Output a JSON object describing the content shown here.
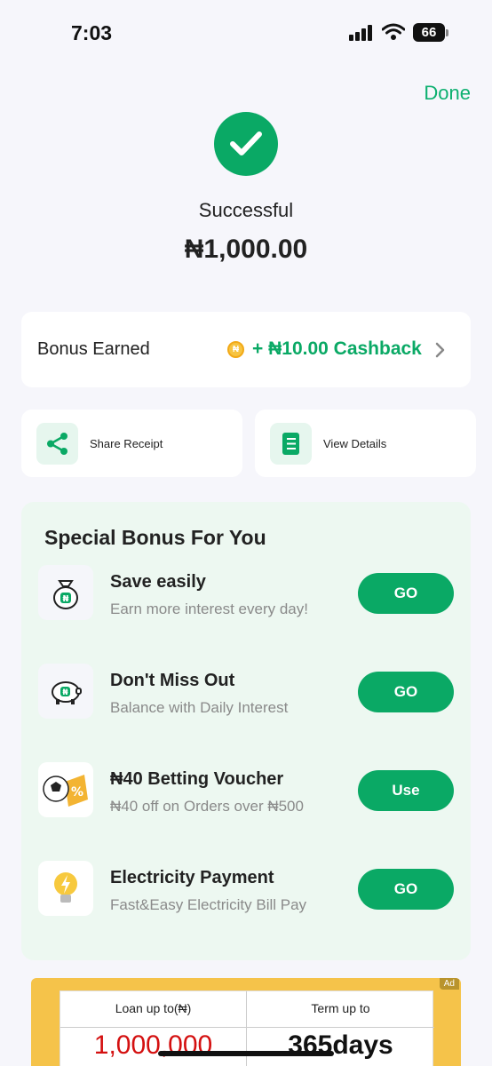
{
  "status_bar": {
    "time": "7:03",
    "battery": "66"
  },
  "header": {
    "done_label": "Done"
  },
  "result": {
    "status": "Successful",
    "amount": "₦1,000.00"
  },
  "bonus": {
    "label": "Bonus Earned",
    "coin_symbol": "₦",
    "cashback": "+ ₦10.00 Cashback"
  },
  "actions": [
    {
      "label": "Share Receipt",
      "icon": "share-icon"
    },
    {
      "label": "View Details",
      "icon": "details-icon"
    }
  ],
  "special": {
    "title": "Special Bonus For You",
    "offers": [
      {
        "title": "Save easily",
        "subtitle": "Earn more interest every day!",
        "button": "GO",
        "icon": "money-bag-icon"
      },
      {
        "title": "Don't Miss Out",
        "subtitle": "Balance with Daily Interest",
        "button": "GO",
        "icon": "piggy-bank-icon"
      },
      {
        "title": "₦40  Betting Voucher",
        "subtitle": "₦40 off on Orders over ₦500",
        "button": "Use",
        "icon": "soccer-voucher-icon"
      },
      {
        "title": "Electricity Payment",
        "subtitle": "Fast&Easy Electricity Bill Pay",
        "button": "GO",
        "icon": "light-bulb-icon"
      }
    ]
  },
  "ad": {
    "tag": "Ad",
    "loan_header": "Loan up to(₦)",
    "term_header": "Term up to",
    "loan_value": "1,000,000",
    "term_value": "365days"
  },
  "colors": {
    "brand": "#0aa965",
    "background": "#f6f6fb",
    "special_bg": "#edf8f1",
    "ad_bg": "#f5c34a"
  }
}
